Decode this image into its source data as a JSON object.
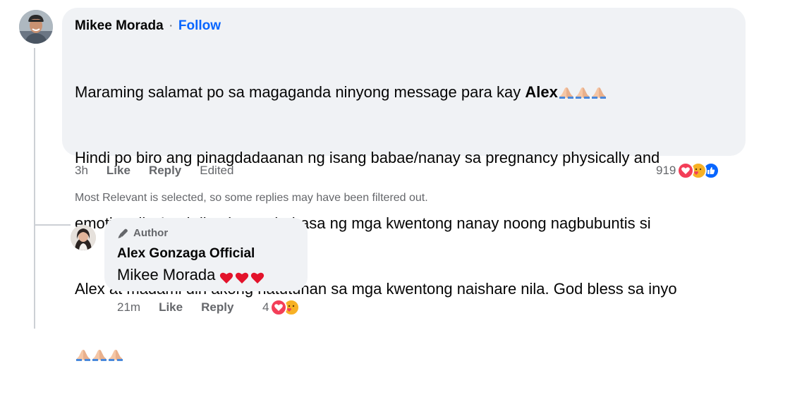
{
  "comment": {
    "author": "Mikee Morada",
    "separator": "·",
    "follow_label": "Follow",
    "line1_prefix": "Maraming salamat po sa magaganda ninyong message para kay ",
    "line1_bold": "Alex",
    "line2": "Hindi po biro ang pinagdadaanan ng isang babae/nanay sa pregnancy physically and",
    "line3": "emotionally. Lagi din ako nagbabasa ng mga kwentong nanay noong nagbubuntis si",
    "line4": "Alex at madami din akong natutunan sa mga kwentong naishare nila. God bless sa inyo",
    "emoji_name": "folded-hands",
    "time": "3h",
    "like_label": "Like",
    "reply_label": "Reply",
    "edited_label": "Edited",
    "reaction_count": "919",
    "reaction_icons": [
      "love-reaction-icon",
      "care-reaction-icon",
      "like-reaction-icon"
    ]
  },
  "filter_note": "Most Relevant is selected, so some replies may have been filtered out.",
  "reply": {
    "badge_label": "Author",
    "author": "Alex Gonzaga Official",
    "mention": "Mikee Morada",
    "time": "21m",
    "like_label": "Like",
    "reply_label": "Reply",
    "reaction_count": "4",
    "reaction_icons": [
      "love-reaction-icon",
      "care-reaction-icon"
    ]
  },
  "colors": {
    "bubble": "#f0f2f5",
    "link": "#0866ff",
    "meta": "#65676b",
    "love": "#f33e58",
    "like": "#0866ff",
    "care": "#f7b125"
  }
}
